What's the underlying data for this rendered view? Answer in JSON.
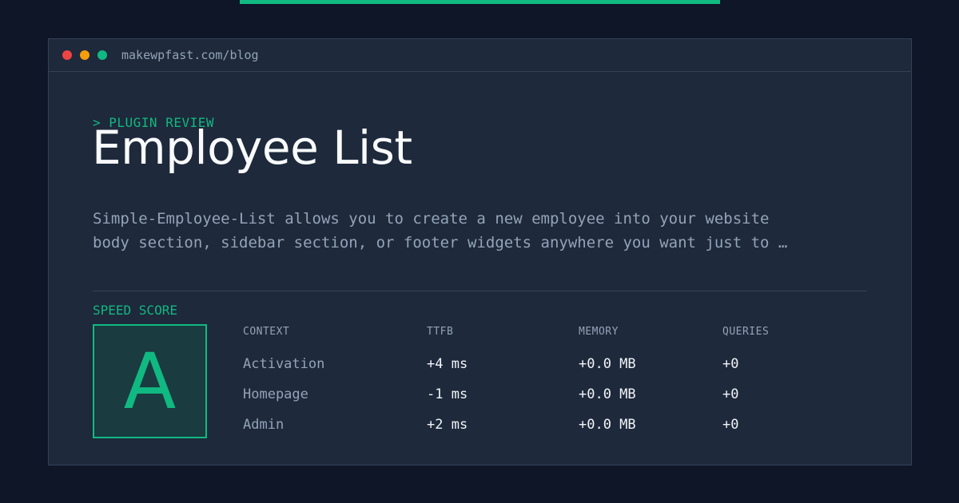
{
  "colors": {
    "background": "#0e1628",
    "panel": "#1e293b",
    "accent": "#10b981",
    "dot_red": "#ef4444",
    "dot_amber": "#f59e0b",
    "dot_green": "#10b981"
  },
  "window": {
    "url": "makewpfast.com/blog"
  },
  "header": {
    "eyebrow": "> PLUGIN REVIEW",
    "title": "Employee List",
    "description": "Simple-Employee-List allows you to create a new employee into your website body section, sidebar section, or footer widgets anywhere you want just to …"
  },
  "score": {
    "label": "SPEED SCORE",
    "grade": "A"
  },
  "table": {
    "headers": [
      "CONTEXT",
      "TTFB",
      "MEMORY",
      "QUERIES"
    ],
    "rows": [
      [
        "Activation",
        "+4 ms",
        "+0.0 MB",
        "+0"
      ],
      [
        "Homepage",
        "-1 ms",
        "+0.0 MB",
        "+0"
      ],
      [
        "Admin",
        "+2 ms",
        "+0.0 MB",
        "+0"
      ]
    ]
  }
}
